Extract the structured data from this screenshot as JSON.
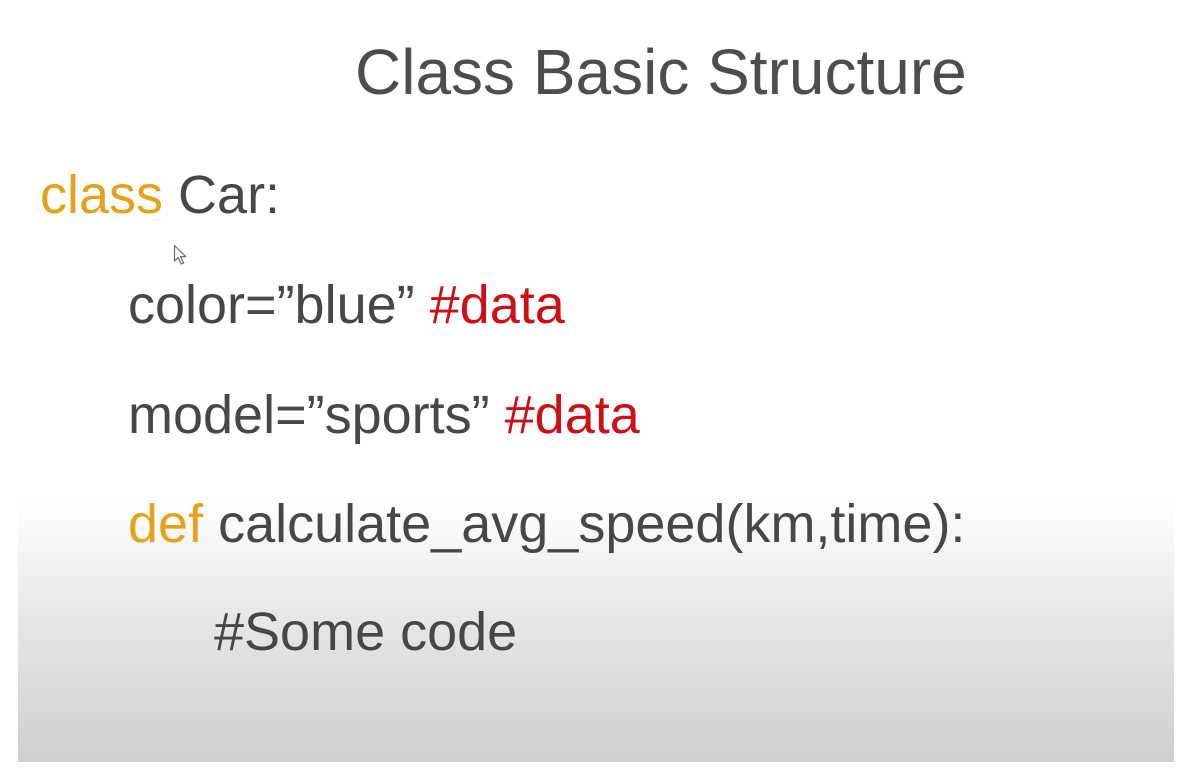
{
  "slide": {
    "title": "Class Basic Structure",
    "code": {
      "class_keyword": "class",
      "class_name": " Car:",
      "line_color_text": "color=”blue” ",
      "line_color_comment": "#data",
      "line_model_text": "model=”sports” ",
      "line_model_comment": "#data",
      "def_keyword": "def",
      "def_signature": " calculate_avg_speed(km,time):",
      "body_comment": "#Some code"
    }
  },
  "colors": {
    "keyword": "#e3a21a",
    "comment": "#cc1016",
    "text": "#474747",
    "background": "#ffffff"
  },
  "icons": {
    "cursor": "mouse-pointer-icon"
  }
}
